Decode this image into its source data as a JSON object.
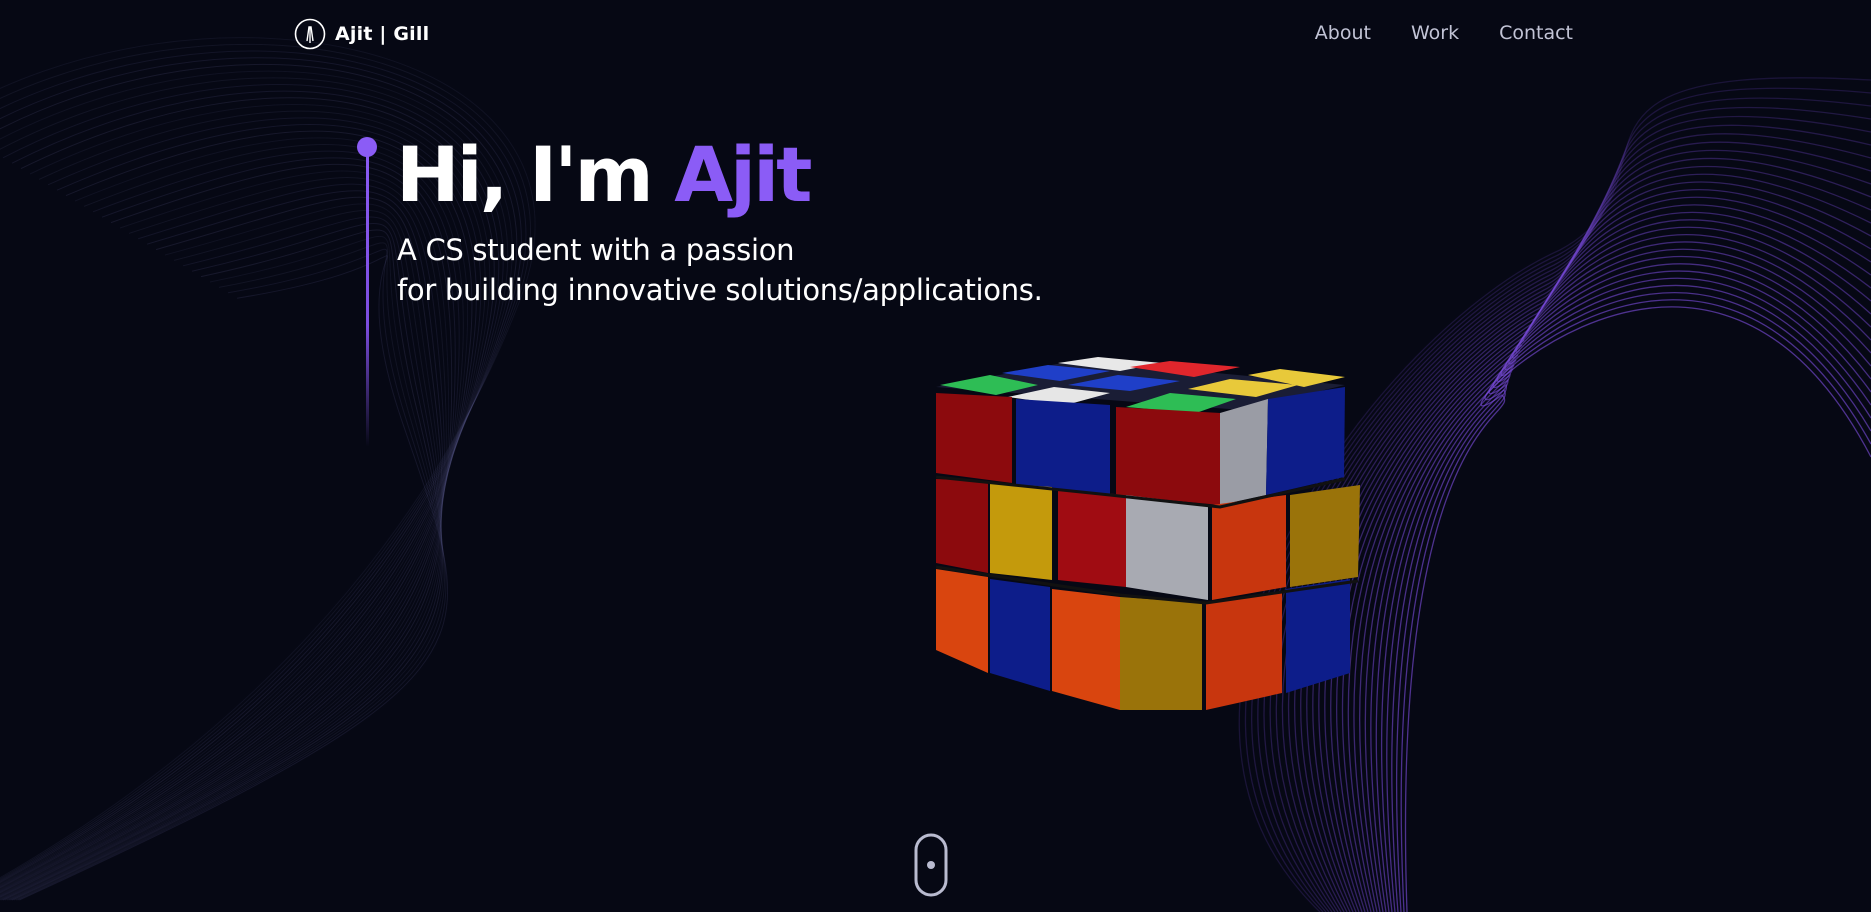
{
  "header": {
    "logo_text": "Ajit | Gill",
    "logo_icon": "monogram-icon",
    "nav": [
      {
        "label": "About"
      },
      {
        "label": "Work"
      },
      {
        "label": "Contact"
      }
    ]
  },
  "hero": {
    "greeting": "Hi, I'm",
    "name": "Ajit",
    "subtitle_line1": "A CS student with a passion",
    "subtitle_line2": "for building innovative solutions/applications."
  },
  "scroll": {
    "icon": "mouse-scroll-icon"
  },
  "colors": {
    "background": "#060814",
    "accent": "#8b5cf6",
    "nav_text": "#c2c4d6",
    "text": "#ffffff"
  }
}
